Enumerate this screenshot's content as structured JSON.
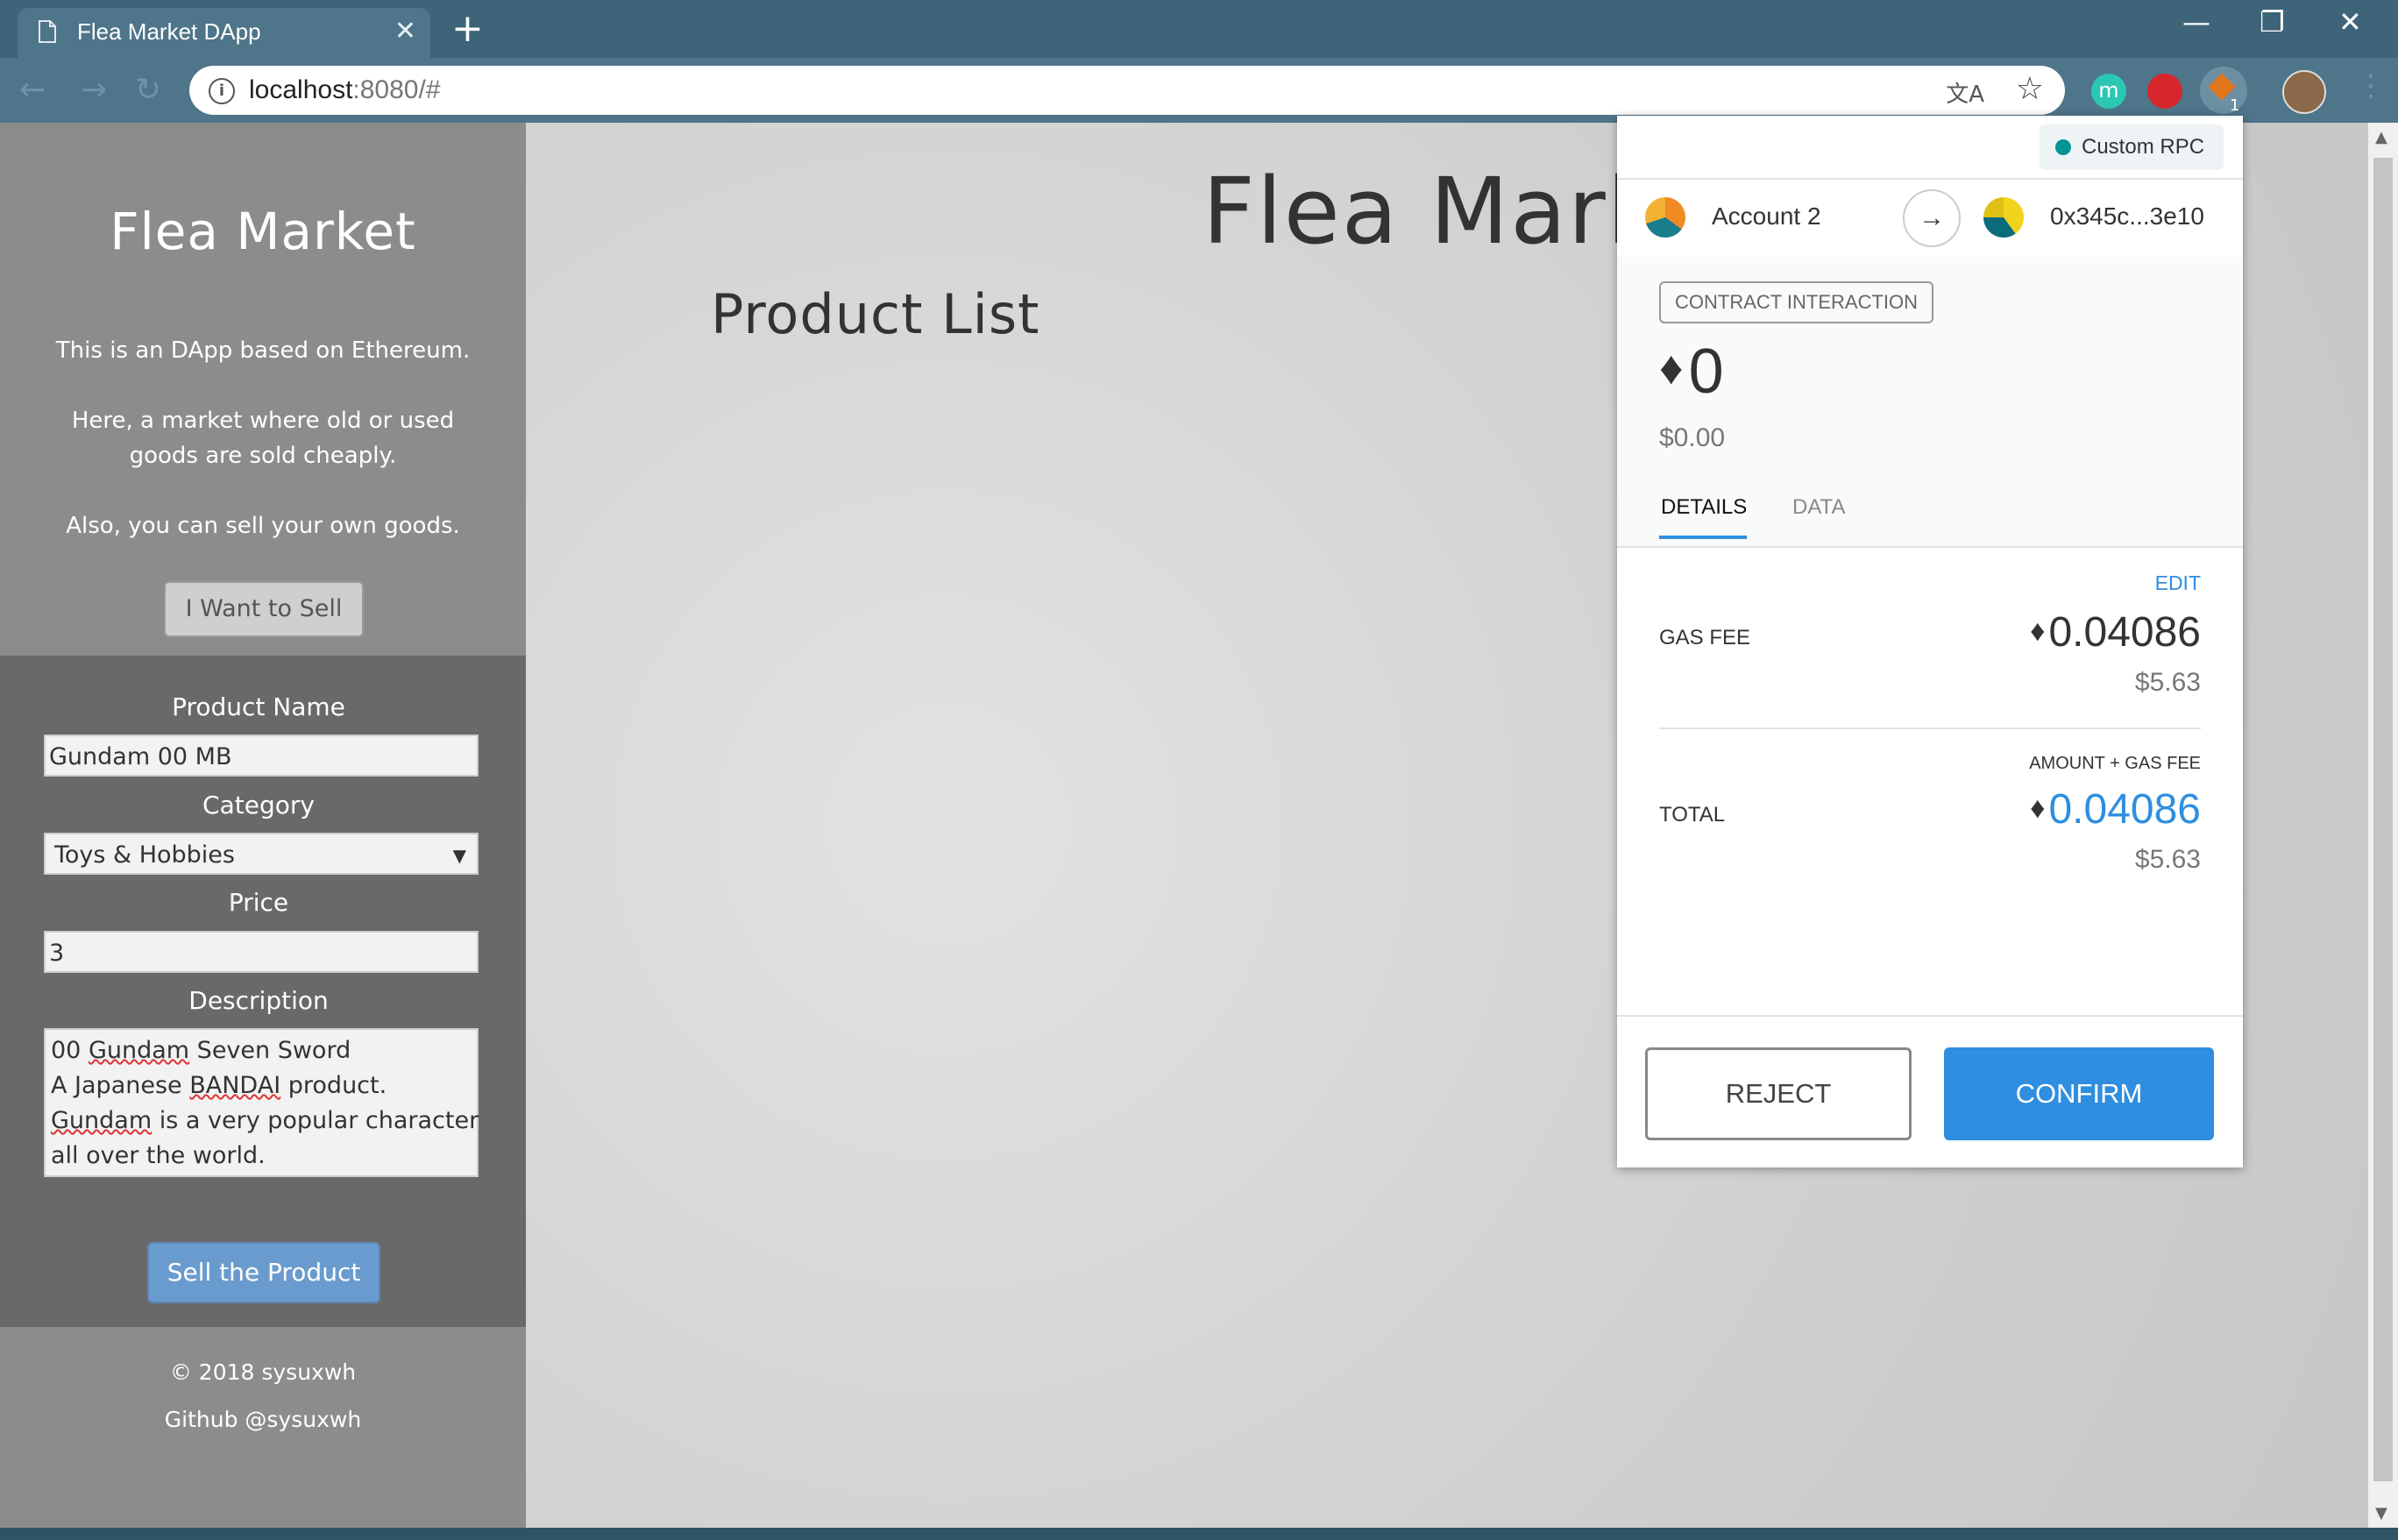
{
  "browser": {
    "tab_title": "Flea Market DApp",
    "tab_close": "✕",
    "new_tab": "+",
    "url_host": "localhost",
    "url_rest": ":8080/#",
    "ext_m_letter": "m",
    "ext_badge": "1",
    "window_controls": {
      "minimize": "—",
      "restore": "❐",
      "close": "✕"
    },
    "nav": {
      "back": "←",
      "forward": "→",
      "reload": "↻"
    }
  },
  "sidebar": {
    "title": "Flea Market",
    "intro_1": "This is an DApp based on Ethereum.",
    "intro_2": "Here, a market where old or used goods are sold cheaply.",
    "intro_3": "Also, you can sell your own goods.",
    "want_button": "I Want to Sell",
    "form": {
      "name_label": "Product Name",
      "name_value": "Gundam 00 MB",
      "category_label": "Category",
      "category_value": "Toys & Hobbies",
      "price_label": "Price",
      "price_value": "3",
      "description_label": "Description",
      "description_lines": [
        [
          "00 ",
          "Gundam",
          " Seven Sword"
        ],
        [
          "A Japanese ",
          "BANDAI",
          " product."
        ],
        [
          "",
          "Gundam",
          " is a very popular character"
        ],
        [
          "all over the world.",
          "",
          ""
        ]
      ],
      "sell_button": "Sell the Product"
    },
    "footer": {
      "copyright": "© 2018 sysuxwh",
      "github": "Github @sysuxwh"
    }
  },
  "main": {
    "title": "Flea Market",
    "subtitle": "Product List"
  },
  "metamask": {
    "network": "Custom RPC",
    "from_account": "Account 2",
    "to_address": "0x345c...3e10",
    "badge": "CONTRACT INTERACTION",
    "amount_eth": "0",
    "amount_fiat": "$0.00",
    "tabs": {
      "details": "DETAILS",
      "data": "DATA",
      "active": "details"
    },
    "edit": "EDIT",
    "gas_fee_label": "GAS FEE",
    "gas_fee_eth": "0.04086",
    "gas_fee_fiat": "$5.63",
    "amount_plus_gas_label": "AMOUNT + GAS FEE",
    "total_label": "TOTAL",
    "total_eth": "0.04086",
    "total_fiat": "$5.63",
    "reject": "REJECT",
    "confirm": "CONFIRM",
    "accent_color": "#2f8ee0"
  }
}
